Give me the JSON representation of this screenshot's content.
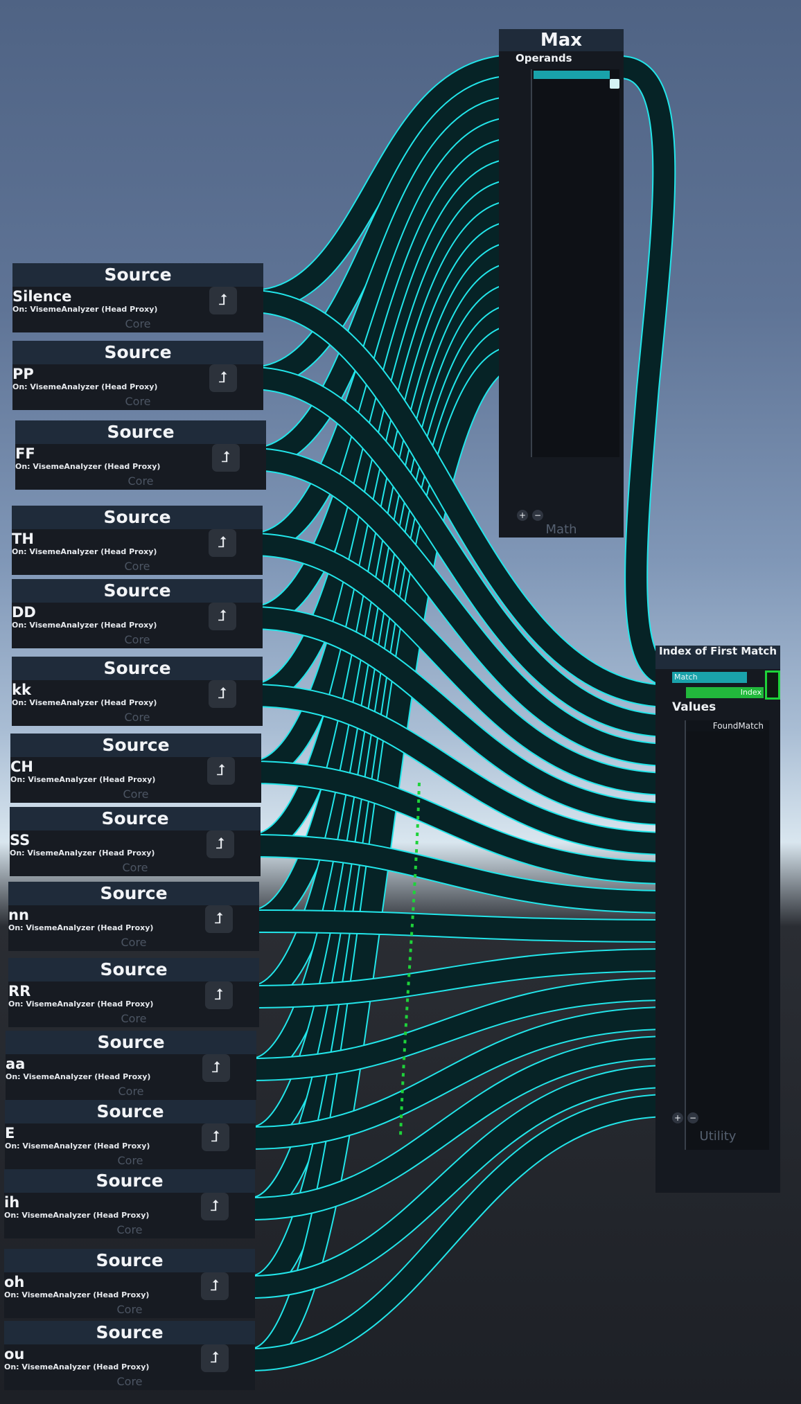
{
  "source_nodes": [
    {
      "header": "Source",
      "name": "Silence",
      "subtitle": "On: VisemeAnalyzer (Head Proxy)",
      "category": "Core"
    },
    {
      "header": "Source",
      "name": "PP",
      "subtitle": "On: VisemeAnalyzer (Head Proxy)",
      "category": "Core"
    },
    {
      "header": "Source",
      "name": "FF",
      "subtitle": "On: VisemeAnalyzer (Head Proxy)",
      "category": "Core"
    },
    {
      "header": "Source",
      "name": "TH",
      "subtitle": "On: VisemeAnalyzer (Head Proxy)",
      "category": "Core"
    },
    {
      "header": "Source",
      "name": "DD",
      "subtitle": "On: VisemeAnalyzer (Head Proxy)",
      "category": "Core"
    },
    {
      "header": "Source",
      "name": "kk",
      "subtitle": "On: VisemeAnalyzer (Head Proxy)",
      "category": "Core"
    },
    {
      "header": "Source",
      "name": "CH",
      "subtitle": "On: VisemeAnalyzer (Head Proxy)",
      "category": "Core"
    },
    {
      "header": "Source",
      "name": "SS",
      "subtitle": "On: VisemeAnalyzer (Head Proxy)",
      "category": "Core"
    },
    {
      "header": "Source",
      "name": "nn",
      "subtitle": "On: VisemeAnalyzer (Head Proxy)",
      "category": "Core"
    },
    {
      "header": "Source",
      "name": "RR",
      "subtitle": "On: VisemeAnalyzer (Head Proxy)",
      "category": "Core"
    },
    {
      "header": "Source",
      "name": "aa",
      "subtitle": "On: VisemeAnalyzer (Head Proxy)",
      "category": "Core"
    },
    {
      "header": "Source",
      "name": "E",
      "subtitle": "On: VisemeAnalyzer (Head Proxy)",
      "category": "Core"
    },
    {
      "header": "Source",
      "name": "ih",
      "subtitle": "On: VisemeAnalyzer (Head Proxy)",
      "category": "Core"
    },
    {
      "header": "Source",
      "name": "oh",
      "subtitle": "On: VisemeAnalyzer (Head Proxy)",
      "category": "Core"
    },
    {
      "header": "Source",
      "name": "ou",
      "subtitle": "On: VisemeAnalyzer (Head Proxy)",
      "category": "Core"
    }
  ],
  "max_node": {
    "title": "Max",
    "operands_label": "Operands",
    "add_label": "+",
    "remove_label": "−",
    "category": "Math"
  },
  "index_node": {
    "title": "Index of First Match",
    "match_label": "Match",
    "index_label": "Index",
    "values_label": "Values",
    "found_match_label": "FoundMatch",
    "add_label": "+",
    "remove_label": "−",
    "category": "Utility"
  },
  "icons": {
    "jump": "jump-arrow-icon"
  },
  "colors": {
    "wire": "#22e6ea",
    "wire_fill": "#062326",
    "node_header": "#1f2b3a",
    "node_body": "#171b22",
    "index_output": "#1ed33a"
  }
}
